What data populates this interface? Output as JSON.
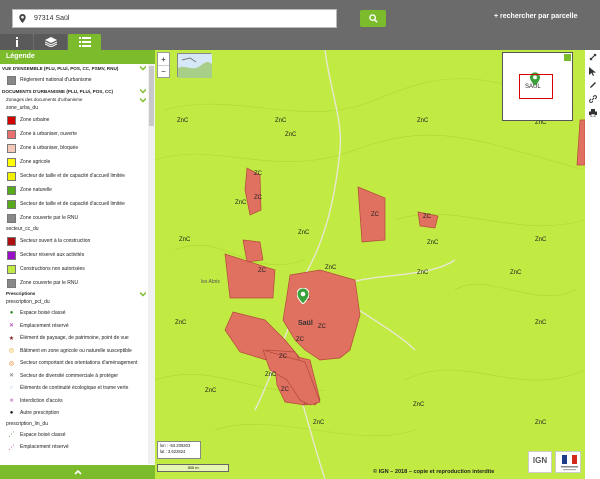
{
  "search": {
    "value": "97314 Saül"
  },
  "header": {
    "parcel_link": "+ rechercher par parcelle"
  },
  "tabs": [
    {
      "icon": "info-icon"
    },
    {
      "icon": "layers-icon"
    },
    {
      "icon": "list-icon"
    }
  ],
  "legend": {
    "title": "Légende",
    "section1": "VUE D'ENSEMBLE (PLU, PLUi, POS, CC, PSMV, RNU)",
    "rnu_label": "Règlement national d'urbanisme",
    "section2": "DOCUMENTS D'URBANISME (PLU, PLUi, POS, CC)",
    "zonages_title": "Zonages des documents d'urbanisme",
    "zone_urba_du": "zone_urba_du",
    "zones": [
      {
        "label": "Zone urbaine",
        "color": "#d40000"
      },
      {
        "label": "Zone à urbaniser, ouverte",
        "color": "#e87070"
      },
      {
        "label": "Zone à urbaniser, bloquée",
        "color": "#f6c8b8"
      },
      {
        "label": "Zone agricole",
        "color": "#ffff00"
      },
      {
        "label": "Secteur de taille et de capacité d'accueil limitée",
        "color": "#f0f000"
      },
      {
        "label": "Zone naturelle",
        "color": "#56aa1c"
      },
      {
        "label": "Secteur de taille et de capacité d'accueil limitée",
        "color": "#56aa1c"
      },
      {
        "label": "Zone couverte par le RNU",
        "color": "#888888"
      }
    ],
    "secteur_cc_du": "secteur_cc_du",
    "secteurs": [
      {
        "label": "Secteur ouvert à la construction",
        "color": "#b01010"
      },
      {
        "label": "Secteur réservé aux activités",
        "color": "#9a10c8"
      },
      {
        "label": "Constructions non autorisées",
        "color": "#c1ea42"
      },
      {
        "label": "Zone couverte par le RNU",
        "color": "#888888"
      }
    ],
    "prescriptions_title": "Prescriptions",
    "prescription_pct_du": "prescription_pct_du",
    "prescriptions": [
      {
        "label": "Espace boisé classé",
        "glyph": "●",
        "color": "#2a8a2a"
      },
      {
        "label": "Emplacement réservé",
        "glyph": "✕",
        "color": "#a020a0"
      },
      {
        "label": "Élément de paysage, de patrimoine, point de vue",
        "glyph": "★",
        "color": "#8b2222"
      },
      {
        "label": "Bâtiment en zone agricole ou naturelle susceptible",
        "glyph": "◎",
        "color": "#e8a000"
      },
      {
        "label": "Secteur comportant des orientations d'aménagement",
        "glyph": "◎",
        "color": "#e06a00"
      },
      {
        "label": "Secteur de diversité commerciale à protéger",
        "glyph": "✕",
        "color": "#666666"
      },
      {
        "label": "Éléments de continuité écologique et trame verte",
        "glyph": "◌",
        "color": "#2a70c8"
      },
      {
        "label": "Interdiction d'accès",
        "glyph": "■",
        "color": "#d8a0d8"
      },
      {
        "label": "Autre prescription",
        "glyph": "●",
        "color": "#111111"
      }
    ],
    "prescription_lin_du": "prescription_lin_du",
    "lin": [
      {
        "label": "Espace boisé classé",
        "glyph": "⋰",
        "color": "#2a8a2a"
      },
      {
        "label": "Emplacement réservé",
        "glyph": "⋰",
        "color": "#a020a0"
      }
    ]
  },
  "map": {
    "zone_labels": [
      {
        "text": "ZnC"
      },
      {
        "text": "ZnC"
      },
      {
        "text": "ZnC"
      },
      {
        "text": "ZnC"
      },
      {
        "text": "ZnC"
      },
      {
        "text": "ZnC"
      },
      {
        "text": "ZnC"
      },
      {
        "text": "ZnC"
      },
      {
        "text": "ZnC"
      },
      {
        "text": "ZnC"
      },
      {
        "text": "ZnC"
      },
      {
        "text": "ZnC"
      },
      {
        "text": "ZnC"
      },
      {
        "text": "ZnC"
      },
      {
        "text": "ZnC"
      },
      {
        "text": "ZnC"
      },
      {
        "text": "ZnC"
      },
      {
        "text": "ZnC"
      },
      {
        "text": "ZnC"
      },
      {
        "text": "ZnC"
      },
      {
        "text": "ZC"
      },
      {
        "text": "ZC"
      },
      {
        "text": "ZC"
      },
      {
        "text": "ZC"
      },
      {
        "text": "ZC"
      },
      {
        "text": "ZC"
      },
      {
        "text": "ZC"
      },
      {
        "text": "ZC"
      },
      {
        "text": "ZC"
      },
      {
        "text": "ZC"
      }
    ],
    "place_labels": [
      {
        "text": "Saül"
      },
      {
        "text": "les Abris"
      }
    ],
    "overview_label": "SAUL",
    "coord_lon": "lon : -53.209303",
    "coord_lat": "lat : 3.622824",
    "scale": "300 m",
    "copyright": "© IGN – 2018 – copie et reproduction interdite",
    "ign_logo": "IGN"
  },
  "colors": {
    "accent": "#7cbc2c",
    "map_green": "#c1ea42",
    "zone_red": "#e07060"
  }
}
